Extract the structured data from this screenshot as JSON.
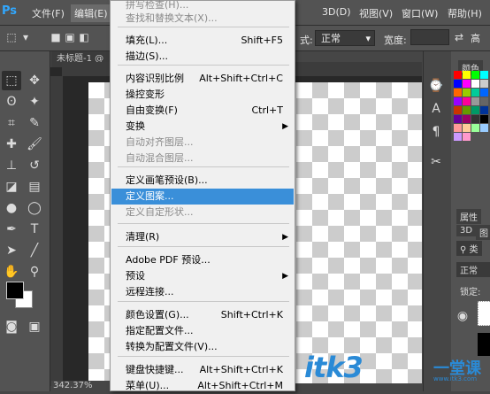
{
  "app": {
    "logo": "Ps"
  },
  "menubar": {
    "items": [
      "文件(F)",
      "编辑(E)",
      "3D(D)",
      "视图(V)",
      "窗口(W)",
      "帮助(H)"
    ]
  },
  "options": {
    "style_label": "式:",
    "mode_value": "正常",
    "width_label": "宽度:"
  },
  "document": {
    "tab_title": "未标题-1 @",
    "zoom": "342.37%"
  },
  "edit_menu": {
    "items": [
      {
        "label": "拼写检查(H)...",
        "shortcut": "",
        "disabled": true,
        "submenu": false
      },
      {
        "label": "查找和替换文本(X)...",
        "shortcut": "",
        "disabled": true,
        "submenu": false
      },
      {
        "label": "填充(L)...",
        "shortcut": "Shift+F5",
        "disabled": false,
        "submenu": false
      },
      {
        "label": "描边(S)...",
        "shortcut": "",
        "disabled": false,
        "submenu": false
      },
      {
        "label": "内容识别比例",
        "shortcut": "Alt+Shift+Ctrl+C",
        "disabled": false,
        "submenu": false
      },
      {
        "label": "操控变形",
        "shortcut": "",
        "disabled": false,
        "submenu": false
      },
      {
        "label": "自由变换(F)",
        "shortcut": "Ctrl+T",
        "disabled": false,
        "submenu": false
      },
      {
        "label": "变换",
        "shortcut": "",
        "disabled": false,
        "submenu": true
      },
      {
        "label": "自动对齐图层...",
        "shortcut": "",
        "disabled": true,
        "submenu": false
      },
      {
        "label": "自动混合图层...",
        "shortcut": "",
        "disabled": true,
        "submenu": false
      },
      {
        "label": "定义画笔预设(B)...",
        "shortcut": "",
        "disabled": false,
        "submenu": false
      },
      {
        "label": "定义图案...",
        "shortcut": "",
        "disabled": false,
        "submenu": false,
        "highlighted": true
      },
      {
        "label": "定义自定形状...",
        "shortcut": "",
        "disabled": true,
        "submenu": false
      },
      {
        "label": "清理(R)",
        "shortcut": "",
        "disabled": false,
        "submenu": true
      },
      {
        "label": "Adobe PDF 预设...",
        "shortcut": "",
        "disabled": false,
        "submenu": false
      },
      {
        "label": "预设",
        "shortcut": "",
        "disabled": false,
        "submenu": true
      },
      {
        "label": "远程连接...",
        "shortcut": "",
        "disabled": false,
        "submenu": false
      },
      {
        "label": "颜色设置(G)...",
        "shortcut": "Shift+Ctrl+K",
        "disabled": false,
        "submenu": false
      },
      {
        "label": "指定配置文件...",
        "shortcut": "",
        "disabled": false,
        "submenu": false
      },
      {
        "label": "转换为配置文件(V)...",
        "shortcut": "",
        "disabled": false,
        "submenu": false
      },
      {
        "label": "键盘快捷键...",
        "shortcut": "Alt+Shift+Ctrl+K",
        "disabled": false,
        "submenu": false
      },
      {
        "label": "菜单(U)...",
        "shortcut": "Alt+Shift+Ctrl+M",
        "disabled": false,
        "submenu": false
      }
    ]
  },
  "right_panel": {
    "swatches_tab": "颜色",
    "properties_tab": "属性",
    "tab_3d": "3D",
    "tab_layers": "图",
    "kind_label": "类",
    "blend_value": "正常",
    "lock_label": "锁定:"
  },
  "watermark": {
    "main": "itk3",
    "sub": "一堂课",
    "sub_small": "www.itk3.com"
  },
  "swatch_colors": [
    "#ff0000",
    "#ffff00",
    "#00ff00",
    "#00ffff",
    "#0000ff",
    "#ff00ff",
    "#ffffff",
    "#cccccc",
    "#ff6600",
    "#99cc00",
    "#00cc99",
    "#0066ff",
    "#9900ff",
    "#ff0099",
    "#999999",
    "#666666",
    "#cc3300",
    "#669900",
    "#009966",
    "#003399",
    "#660099",
    "#990066",
    "#333333",
    "#000000",
    "#ff9999",
    "#ffcc99",
    "#99ff99",
    "#99ccff",
    "#cc99ff",
    "#ff99cc"
  ]
}
